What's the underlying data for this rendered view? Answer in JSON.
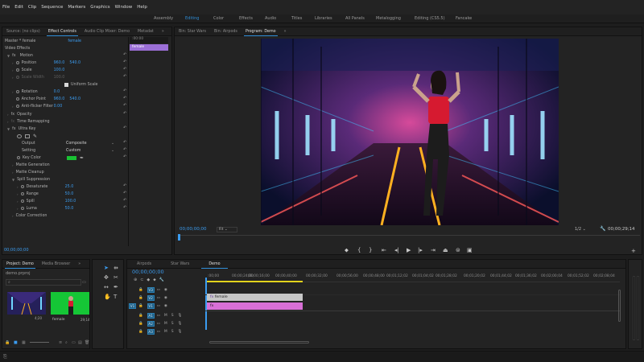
{
  "menu": [
    "File",
    "Edit",
    "Clip",
    "Sequence",
    "Markers",
    "Graphics",
    "Window",
    "Help"
  ],
  "workspaces": {
    "items": [
      "Assembly",
      "Editing",
      "Color",
      "Effects",
      "Audio",
      "Titles",
      "Libraries",
      "All Panels",
      "Metalogging",
      "Editing (CS5.5)",
      "Fancake"
    ],
    "active": "Editing"
  },
  "source_panel": {
    "tabs": [
      "Source: (no clips)",
      "Effect Controls",
      "Audio Clip Mixer: Demo",
      "Metadat"
    ],
    "overflow": "»",
    "master": "Master * female",
    "clip": "female",
    "mini_timecode": ":00:00",
    "mini_clip": "female",
    "video_effects_label": "Video Effects",
    "motion": {
      "label": "Motion",
      "position": {
        "label": "Position",
        "x": "960.0",
        "y": "540.0"
      },
      "scale": {
        "label": "Scale",
        "value": "100.0"
      },
      "scale_width": {
        "label": "Scale Width",
        "value": "100.0"
      },
      "uniform_scale": "Uniform Scale",
      "rotation": {
        "label": "Rotation",
        "value": "0.0"
      },
      "anchor": {
        "label": "Anchor Point",
        "x": "960.0",
        "y": "540.0"
      },
      "anti_flicker": {
        "label": "Anti-flicker Filter",
        "value": "0.00"
      }
    },
    "opacity_label": "Opacity",
    "time_remap_label": "Time Remapping",
    "ultra_key": {
      "label": "Ultra Key",
      "output": {
        "label": "Output",
        "value": "Composite"
      },
      "setting": {
        "label": "Setting",
        "value": "Custom"
      },
      "key_color_label": "Key Color",
      "key_color": "#19c233",
      "matte_generation": "Matte Generation",
      "matte_cleanup": "Matte Cleanup",
      "spill_suppression": "Spill Suppression",
      "desaturate": {
        "label": "Desaturate",
        "value": "25.0"
      },
      "range": {
        "label": "Range",
        "value": "50.0"
      },
      "spill": {
        "label": "Spill",
        "value": "100.0"
      },
      "luma": {
        "label": "Luma",
        "value": "50.0"
      },
      "color_correction": "Color Correction"
    },
    "timecode": "00;00;00;00"
  },
  "program_panel": {
    "tabs": [
      "Bin: Star Wars",
      "Bin: Airpods",
      "Program: Demo"
    ],
    "overflow": "»",
    "timecode": "00;00;00;00",
    "fit": "Fit",
    "quality": "1/2",
    "duration": "00;00;29;14"
  },
  "project_panel": {
    "tabs": [
      "Project: Demo",
      "Media Browser"
    ],
    "overflow": "»",
    "file": "demo.prproj",
    "items": [
      {
        "name": "",
        "duration": "4;20"
      },
      {
        "name": "female",
        "duration": "29;14"
      }
    ]
  },
  "timeline": {
    "tabs": [
      "Airpods",
      "Star Wars",
      "Demo"
    ],
    "timecode": "00;00;00;00",
    "ruler": [
      ":00;00",
      "00;00;16;00",
      "00;00;32;00",
      "00;00;48;00",
      "00;01;04;02",
      "00;01;20;02",
      "00;01;36;02",
      "00;01;52;02",
      "00;02;08;04",
      "00;00;24;00",
      "00;00;40;00",
      "00;00;56;00",
      "00;01;12;02",
      "00;01;28;02",
      "00;01;44;02",
      "00;02;00;04"
    ],
    "tracks": [
      {
        "src": "",
        "name": "V3",
        "kind": "v"
      },
      {
        "src": "",
        "name": "V2",
        "kind": "v"
      },
      {
        "src": "V1",
        "name": "V1",
        "kind": "v"
      },
      {
        "src": "",
        "name": "A1",
        "kind": "a"
      },
      {
        "src": "",
        "name": "A2",
        "kind": "a"
      },
      {
        "src": "",
        "name": "A3",
        "kind": "a"
      }
    ],
    "clips": {
      "v2": "female",
      "v1": "fx"
    },
    "track_toggles": [
      "M",
      "S"
    ]
  },
  "colors": {
    "accent": "#2f8ed8",
    "clip_v2": "#c6c6c6",
    "clip_v1": "#d86fd6",
    "timecode": "#3b9cf0"
  }
}
